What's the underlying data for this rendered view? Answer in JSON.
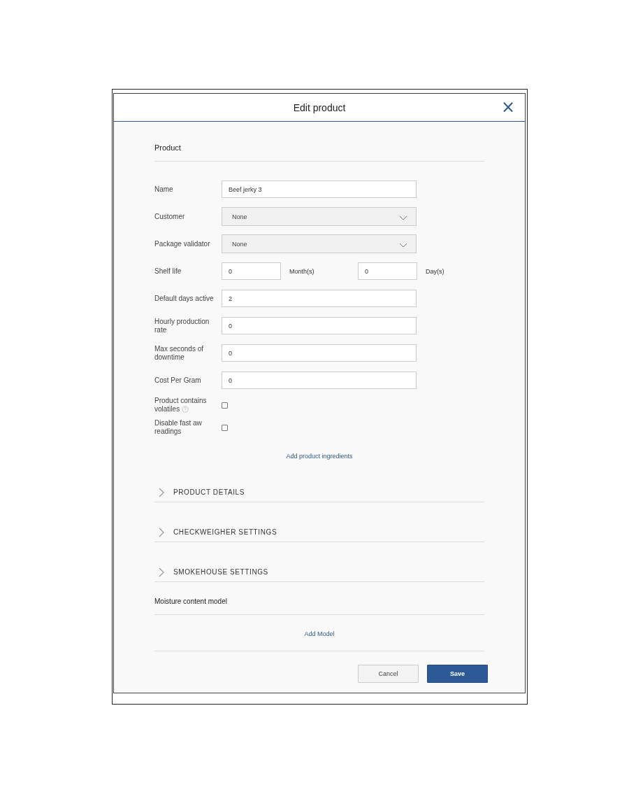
{
  "dialog": {
    "title": "Edit product",
    "close": "×"
  },
  "product": {
    "heading": "Product",
    "fields": [
      {
        "kind": "text",
        "label": "Name",
        "value": "Beef jerky 3"
      },
      {
        "kind": "select",
        "label": "Customer",
        "value": "None"
      },
      {
        "kind": "select",
        "label": "Package validator",
        "value": "None"
      },
      {
        "kind": "pair",
        "label": "Shelf life",
        "value": "0",
        "unit": "Month(s)",
        "value2": "0",
        "unit2": "Day(s)"
      },
      {
        "kind": "text",
        "label": "Default days active",
        "value": "2"
      },
      {
        "kind": "text",
        "label": "Hourly production rate",
        "value": "0"
      },
      {
        "kind": "text",
        "label": "Max seconds of downtime",
        "value": "0"
      },
      {
        "kind": "text",
        "label": "Cost Per Gram",
        "value": "0"
      },
      {
        "kind": "checkbox",
        "label": "Product contains volatiles",
        "help": true,
        "checked": false
      },
      {
        "kind": "checkbox",
        "label": "Disable fast aw readings",
        "help": false,
        "checked": false
      }
    ],
    "link": "Add product ingredients"
  },
  "sections": [
    {
      "label": "PRODUCT DETAILS",
      "expanded": false
    },
    {
      "label": "CHECKWEIGHER SETTINGS",
      "expanded": false
    },
    {
      "label": "SMOKEHOUSE SETTINGS",
      "expanded": false
    }
  ],
  "moisture": {
    "heading": "Moisture content model",
    "link": "Add Model"
  },
  "buttons": [
    {
      "kind": "secondary",
      "label": "Cancel"
    },
    {
      "kind": "primary",
      "label": "Save"
    }
  ]
}
